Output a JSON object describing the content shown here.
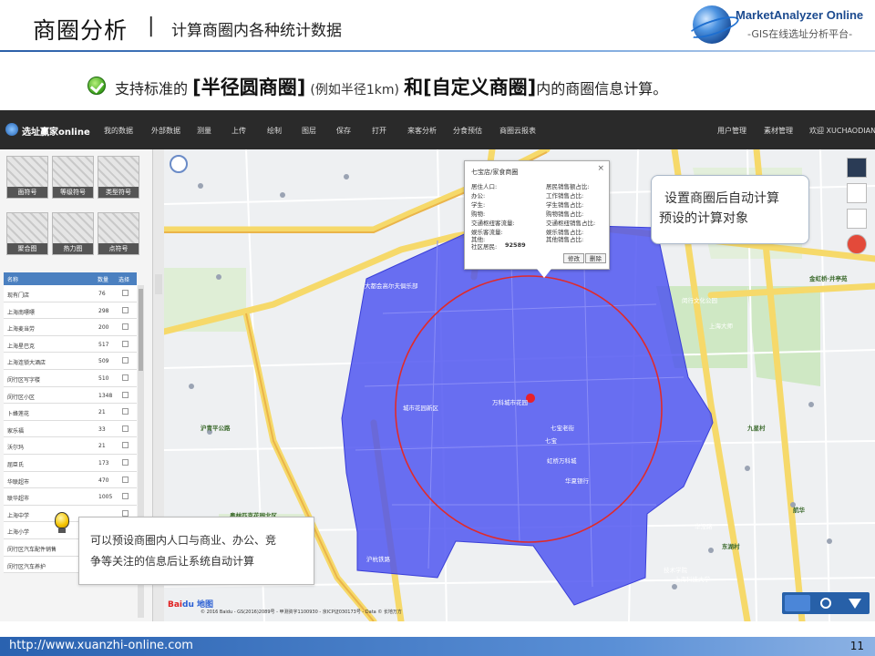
{
  "header": {
    "title": "商圈分析",
    "separator": "|",
    "subtitle": "计算商圈内各种统计数据",
    "brand_name": "MarketAnalyzer Online",
    "brand_tagline": "-GIS在线选址分析平台-"
  },
  "claim": {
    "prefix": "支持标准的",
    "term1": "[半径圆商圈]",
    "note": "(例如半径1km)",
    "and": "和",
    "term2": "[自定义商圈]",
    "suffix": "内的商圈信息计算。"
  },
  "app": {
    "name": "选址赢家online",
    "menu": [
      "我的数据",
      "外部数据",
      "测量",
      "上传",
      "绘制",
      "图层",
      "保存",
      "打开",
      "来客分析",
      "分食预估",
      "商圈云报表"
    ],
    "menu_right": [
      "用户管理",
      "素材管理",
      "欢迎 XUCHAODIAN!"
    ],
    "tiles": [
      "面符号",
      "等级符号",
      "类型符号",
      "聚合图",
      "热力图",
      "点符号"
    ],
    "list_headers": [
      "名称",
      "数量",
      "选择"
    ],
    "list_rows": [
      {
        "name": "现有门店",
        "count": "76"
      },
      {
        "name": "上海南嘌嘌",
        "count": "298"
      },
      {
        "name": "上海麦当劳",
        "count": "200"
      },
      {
        "name": "上海星巴克",
        "count": "517"
      },
      {
        "name": "上海连锁大酒店",
        "count": "509"
      },
      {
        "name": "闵行区写字楼",
        "count": "510"
      },
      {
        "name": "闵行区小区",
        "count": "1348"
      },
      {
        "name": "卜蜂莲花",
        "count": "21"
      },
      {
        "name": "家乐福",
        "count": "33"
      },
      {
        "name": "沃尔玛",
        "count": "21"
      },
      {
        "name": "屈臣氏",
        "count": "173"
      },
      {
        "name": "华联超市",
        "count": "470"
      },
      {
        "name": "联华超市",
        "count": "1005"
      },
      {
        "name": "上海中学",
        "count": ""
      },
      {
        "name": "上海小学",
        "count": ""
      },
      {
        "name": "闵行区汽车配件销售",
        "count": ""
      },
      {
        "name": "闵行区汽车养护",
        "count": ""
      }
    ]
  },
  "popup": {
    "title": "七宝店/家食商圈",
    "left_fields": [
      "居住人口:",
      "办公:",
      "学生:",
      "购物:",
      "交通枢纽客流量:",
      "娱乐客流量:",
      "其他:"
    ],
    "right_fields": [
      "居民销售额占比:",
      "工作销售占比:",
      "学生销售占比:",
      "购物销售占比:",
      "交通枢纽销售占比:",
      "娱乐销售占比:",
      "其他销售占比:"
    ],
    "population_label": "社区居民:",
    "population_value": "92589",
    "edit_button": "修改",
    "delete_button": "删除"
  },
  "map": {
    "labels": [
      "七宝",
      "虹桥万科城",
      "万科城市花园",
      "城市花园新区",
      "华夏银行",
      "闵行文化公园",
      "上海大师",
      "金虹桥·井亭苑",
      "东湖村",
      "华泾路",
      "九星村",
      "航华",
      "上海科技大学",
      "沪青平公路",
      "大都会高尔夫俱乐部",
      "七宝老街",
      "技术学院",
      "奥林匹克花园北区",
      "沪杭铁路"
    ],
    "copyright": "© 2016 Baidu - GS(2016)2089号 - 甲测资字1100930 - 京ICP证030173号 - Data © 长地万方",
    "baidu_logo_1": "Bai",
    "baidu_logo_2": "du 地图"
  },
  "callouts": {
    "top_line1": "设置商圈后自动计算",
    "top_line2": "预设的计算对象",
    "bottom_line1": "可以预设商圈内人口与商业、办公、竞",
    "bottom_line2": "争等关注的信息后让系统自动计算"
  },
  "footer": {
    "url": "http://www.xuanzhi-online.com",
    "page": "11"
  },
  "colors": {
    "polygon_fill": "#4b50f0",
    "circle_stroke": "#e02a2a",
    "topbar": "#2a2a2a",
    "footer": "#2a62b0"
  }
}
